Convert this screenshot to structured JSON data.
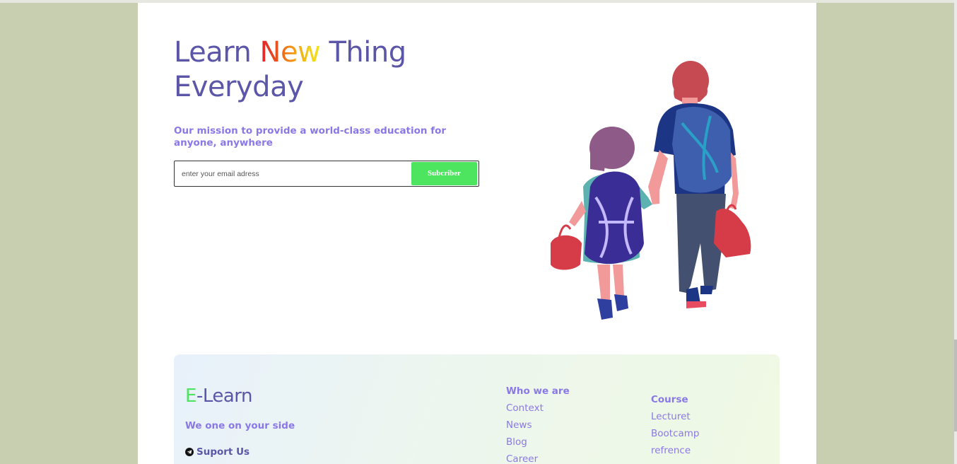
{
  "hero": {
    "title_part1": "Learn ",
    "title_highlight": "New",
    "title_part2": " Thing",
    "title_line2": "Everyday",
    "mission": "Our mission to provide a world-class education for anyone, anywhere"
  },
  "subscribe": {
    "placeholder": "enter your email adress",
    "button_label": "Subcriber"
  },
  "footer": {
    "brand_first": "E",
    "brand_rest": "-Learn",
    "tagline": "We one on your side",
    "support_label": "Suport Us",
    "col1": {
      "heading": "Who we are",
      "links": [
        "Context",
        "News",
        "Blog",
        "Career"
      ]
    },
    "col2": {
      "heading": "Course",
      "links": [
        "Lecturet",
        "Bootcamp",
        "refrence"
      ]
    }
  },
  "colors": {
    "background": "#c8ceb0",
    "primary": "#5b56a8",
    "accent_purple": "#8a78e6",
    "accent_green": "#4de45f"
  },
  "icons": {
    "support": "telegram-icon",
    "illustration": "children-walking-illustration"
  }
}
